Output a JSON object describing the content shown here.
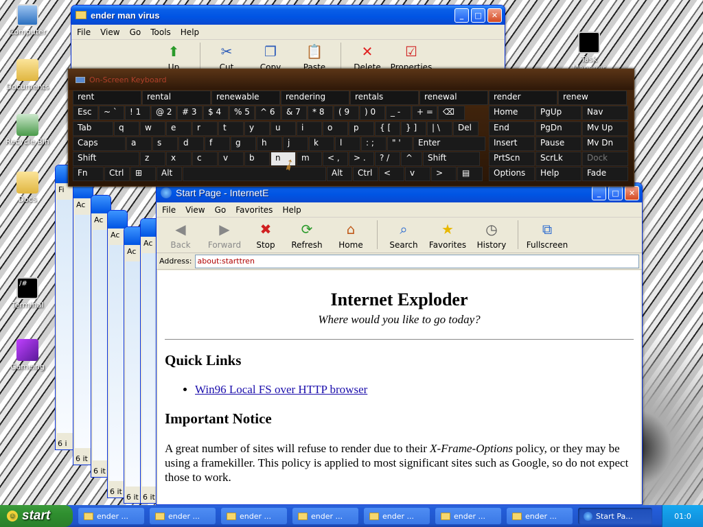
{
  "desktop": {
    "icons": [
      {
        "label": "Computer"
      },
      {
        "label": "Documents"
      },
      {
        "label": "Recycle Bin"
      },
      {
        "label": "Docs"
      },
      {
        "label": "Terminal"
      },
      {
        "label": "Gameing"
      },
      {
        "label": "Task Manager"
      }
    ]
  },
  "explorer": {
    "title": "ender man virus",
    "menu": [
      "File",
      "View",
      "Go",
      "Tools",
      "Help"
    ],
    "toolbar": [
      "Up",
      "Cut",
      "Copy",
      "Paste",
      "Delete",
      "Properties"
    ]
  },
  "stacked_windows": {
    "menu_partial": [
      "Fi",
      "Ac",
      "Ac",
      "Ac",
      "Ac",
      "Ac"
    ],
    "footer_partial": [
      "6 i",
      "6 it",
      "6 it",
      "6 it",
      "6 it",
      "6 it"
    ]
  },
  "keyboard": {
    "title": "On-Screen Keyboard",
    "suggestions": [
      "rent",
      "rental",
      "renewable",
      "rendering",
      "rentals",
      "renewal",
      "render",
      "renew"
    ],
    "row1": [
      {
        "label": "Esc"
      },
      {
        "label": "~ `"
      },
      {
        "label": "! 1"
      },
      {
        "label": "@ 2"
      },
      {
        "label": "# 3"
      },
      {
        "label": "$ 4"
      },
      {
        "label": "% 5"
      },
      {
        "label": "^ 6"
      },
      {
        "label": "& 7"
      },
      {
        "label": "* 8"
      },
      {
        "label": "( 9"
      },
      {
        "label": ") 0"
      },
      {
        "label": "_ -"
      },
      {
        "label": "+ ="
      },
      {
        "label": "⌫"
      }
    ],
    "row2": [
      {
        "label": "Tab"
      },
      {
        "label": "q"
      },
      {
        "label": "w"
      },
      {
        "label": "e"
      },
      {
        "label": "r"
      },
      {
        "label": "t"
      },
      {
        "label": "y"
      },
      {
        "label": "u"
      },
      {
        "label": "i"
      },
      {
        "label": "o"
      },
      {
        "label": "p"
      },
      {
        "label": "{ ["
      },
      {
        "label": "} ]"
      },
      {
        "label": "| \\"
      },
      {
        "label": "Del"
      }
    ],
    "row3": [
      {
        "label": "Caps"
      },
      {
        "label": "a"
      },
      {
        "label": "s"
      },
      {
        "label": "d"
      },
      {
        "label": "f"
      },
      {
        "label": "g"
      },
      {
        "label": "h"
      },
      {
        "label": "j"
      },
      {
        "label": "k"
      },
      {
        "label": "l"
      },
      {
        "label": ": ;"
      },
      {
        "label": "\" '"
      },
      {
        "label": "Enter"
      }
    ],
    "row4": [
      {
        "label": "Shift"
      },
      {
        "label": "z"
      },
      {
        "label": "x"
      },
      {
        "label": "c"
      },
      {
        "label": "v"
      },
      {
        "label": "b"
      },
      {
        "label": "n"
      },
      {
        "label": "m"
      },
      {
        "label": "< ,"
      },
      {
        "label": "> ."
      },
      {
        "label": "? /"
      },
      {
        "label": "^"
      },
      {
        "label": "Shift"
      }
    ],
    "row5": [
      {
        "label": "Fn"
      },
      {
        "label": "Ctrl"
      },
      {
        "label": "⊞"
      },
      {
        "label": "Alt"
      },
      {
        "label": ""
      },
      {
        "label": "Alt"
      },
      {
        "label": "Ctrl"
      },
      {
        "label": "<"
      },
      {
        "label": "v"
      },
      {
        "label": ">"
      },
      {
        "label": "▤"
      }
    ],
    "nav_keys": [
      [
        "Home",
        "PgUp",
        "Nav"
      ],
      [
        "End",
        "PgDn",
        "Mv Up"
      ],
      [
        "Insert",
        "Pause",
        "Mv Dn"
      ],
      [
        "PrtScn",
        "ScrLk",
        "Dock"
      ],
      [
        "Options",
        "Help",
        "Fade"
      ]
    ],
    "pressed_key": "n"
  },
  "ie": {
    "title": "Start Page - InternetE",
    "menu": [
      "File",
      "View",
      "Go",
      "Favorites",
      "Help"
    ],
    "toolbar": [
      "Back",
      "Forward",
      "Stop",
      "Refresh",
      "Home",
      "Search",
      "Favorites",
      "History",
      "Fullscreen"
    ],
    "address_label": "Address:",
    "address_value": "about:starttren",
    "page": {
      "heading": "Internet Exploder",
      "subtitle": "Where would you like to go today?",
      "quick_links_heading": "Quick Links",
      "link": "Win96 Local FS over HTTP browser",
      "notice_heading": "Important Notice",
      "notice_prefix": "A great number of sites will refuse to render due to their ",
      "notice_em": "X-Frame-Options",
      "notice_suffix": " policy, or they may be using a framekiller. This policy is applied to most significant sites such as Google, so do not expect those to work."
    }
  },
  "taskbar": {
    "start": "start",
    "items": [
      "ender ...",
      "ender ...",
      "ender ...",
      "ender ...",
      "ender ...",
      "ender ...",
      "ender ...",
      "Start Pa..."
    ],
    "clock": "01:0"
  }
}
